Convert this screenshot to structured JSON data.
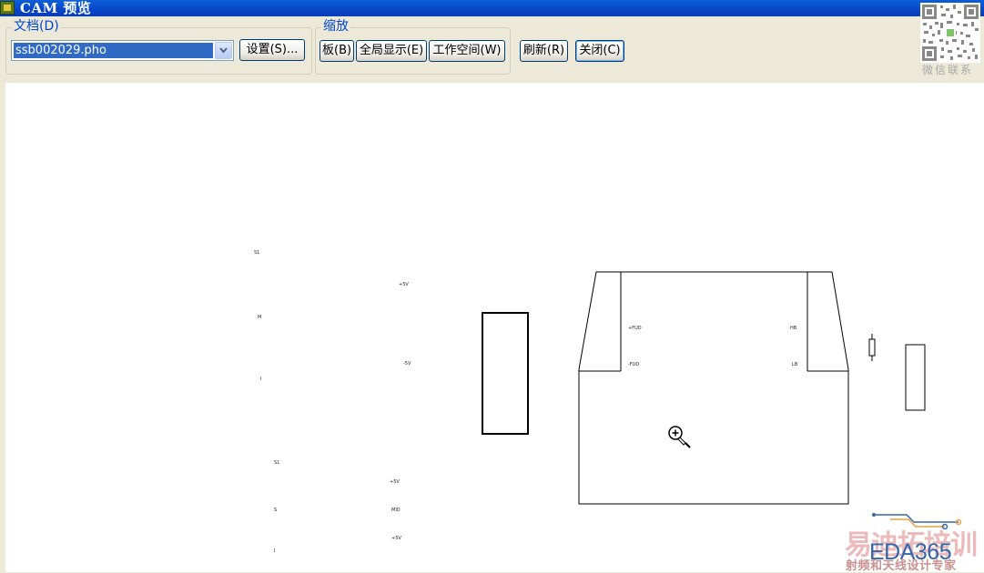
{
  "window": {
    "title": "CAM 预览"
  },
  "toolbar": {
    "document_group": "文档(D)",
    "file_value": "ssb002029.pho",
    "settings_label": "设置(S)...",
    "zoom_group": "缩放",
    "board_label": "板(B)",
    "extents_label": "全局显示(E)",
    "workspace_label": "工作空间(W)",
    "refresh_label": "刷新(R)",
    "close_label": "关闭(C)"
  },
  "preview": {
    "left_labels": [
      "S1",
      "M",
      "I",
      "S1",
      "S",
      "I"
    ],
    "right_labels": [
      "+5V",
      "-5V",
      "+5V",
      "MID",
      "+5V"
    ],
    "board_labels": [
      "+FUD",
      "-FUD",
      "HB",
      "LB"
    ]
  },
  "qr": {
    "caption": "微信联系"
  },
  "watermark": {
    "cn": "易迪拓培训",
    "brand": "EDA365",
    "sub": "射频和天线设计专家"
  },
  "colors": {
    "titlebar": "#0846c8",
    "selection": "#316ac5",
    "group_title": "#0046d5",
    "button_border": "#003c74"
  }
}
